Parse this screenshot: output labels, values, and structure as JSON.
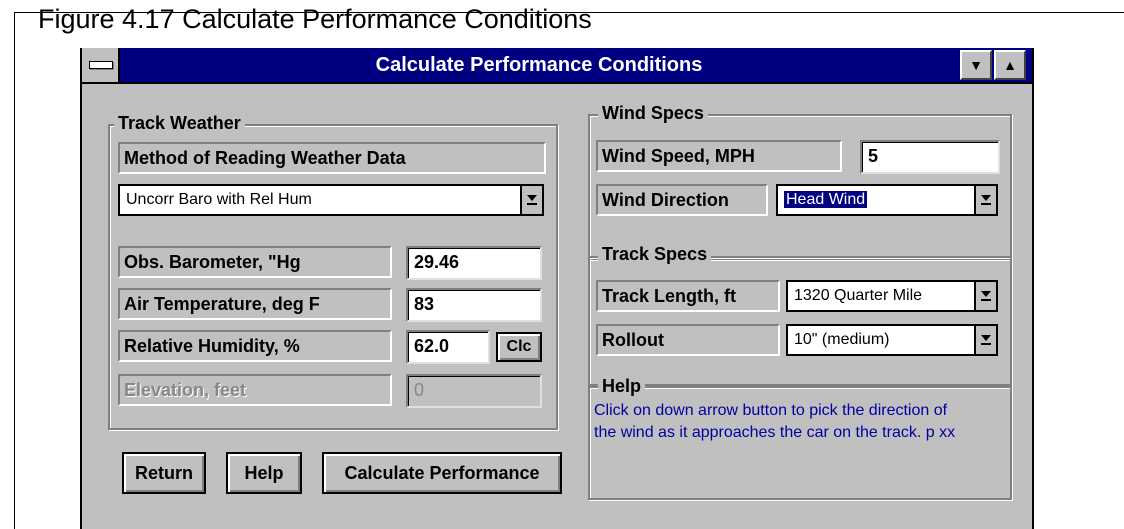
{
  "caption": "Figure 4.17  Calculate Performance Conditions",
  "window": {
    "title": "Calculate Performance Conditions",
    "buttons": {
      "minimize": "▼",
      "maximize": "▲"
    }
  },
  "track_weather": {
    "title": "Track Weather",
    "method_label": "Method of Reading Weather Data",
    "method_value": "Uncorr Baro with Rel Hum",
    "fields": [
      {
        "label": "Obs. Barometer, \"Hg",
        "value": "29.46"
      },
      {
        "label": "Air Temperature, deg F",
        "value": "83"
      },
      {
        "label": "Relative Humidity, %",
        "value": "62.0"
      },
      {
        "label": "Elevation, feet",
        "value": "0"
      }
    ],
    "clc_label": "Clc"
  },
  "wind_specs": {
    "title": "Wind Specs",
    "speed_label": "Wind Speed, MPH",
    "speed_value": "5",
    "direction_label": "Wind Direction",
    "direction_value": "Head Wind"
  },
  "track_specs": {
    "title": "Track Specs",
    "length_label": "Track Length, ft",
    "length_value": "1320  Quarter Mile",
    "rollout_label": "Rollout",
    "rollout_value": "10\" (medium)"
  },
  "help": {
    "title": "Help",
    "line1": "Click on down arrow button to pick the direction of",
    "line2": "the wind as it approaches the car on the track.  p xx"
  },
  "buttons": {
    "return": "Return",
    "help": "Help",
    "calculate": "Calculate Performance"
  }
}
